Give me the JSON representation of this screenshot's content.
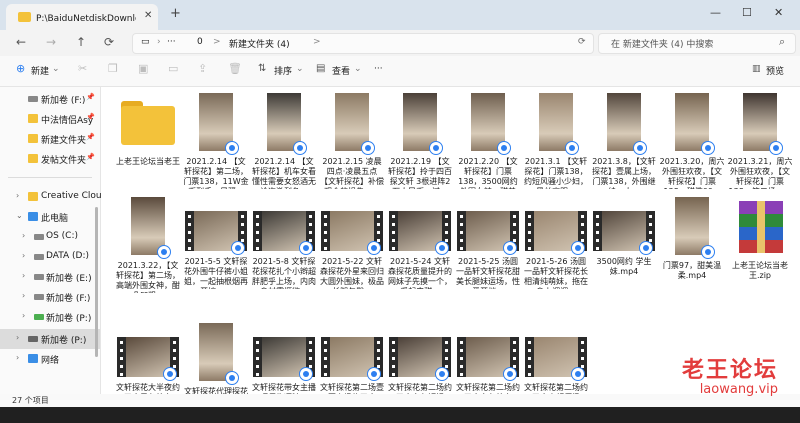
{
  "window": {
    "tab_title": "P:\\BaiduNetdiskDownload\\新建",
    "tab_close": "✕",
    "new_tab": "+",
    "controls": [
      "—",
      "☐",
      "✕"
    ]
  },
  "nav": {
    "back": "←",
    "forward": "→",
    "up": "↑",
    "refresh": "⟳",
    "path_more": "···",
    "path_root": "0",
    "path_sep": ">",
    "path_current": "新建文件夹 (4)",
    "path_chevron": ">",
    "search_placeholder": "在 新建文件夹 (4) 中搜索",
    "search_icon": "search-icon"
  },
  "toolbar": {
    "new_label": "新建",
    "sort_label": "排序",
    "view_label": "查看",
    "more_label": "···",
    "preview_label": "预览",
    "disabled_icons": [
      "cut-icon",
      "copy-icon",
      "paste-icon",
      "rename-icon",
      "share-icon",
      "delete-icon"
    ]
  },
  "sidebar": {
    "items": [
      {
        "label": "新加卷 (F:)",
        "pinned": true,
        "chev": "",
        "icon": "drive"
      },
      {
        "label": "中法情侣Asy",
        "pinned": true,
        "chev": "",
        "icon": "folder"
      },
      {
        "label": "新建文件夹",
        "pinned": true,
        "chev": "",
        "icon": "folder"
      },
      {
        "label": "发帖文件夹",
        "pinned": true,
        "chev": "",
        "icon": "folder"
      },
      {
        "label": "Creative Cloud",
        "pinned": false,
        "chev": "›",
        "icon": "cloud"
      },
      {
        "label": "此电脑",
        "pinned": false,
        "chev": "⌄",
        "icon": "pc"
      },
      {
        "label": "OS (C:)",
        "pinned": false,
        "chev": "›",
        "icon": "drive"
      },
      {
        "label": "DATA (D:)",
        "pinned": false,
        "chev": "›",
        "icon": "drive"
      },
      {
        "label": "新加卷 (E:)",
        "pinned": false,
        "chev": "›",
        "icon": "drive"
      },
      {
        "label": "新加卷 (F:)",
        "pinned": false,
        "chev": "›",
        "icon": "drive"
      },
      {
        "label": "新加卷 (P:)",
        "pinned": false,
        "chev": "›",
        "icon": "drive"
      },
      {
        "label": "新加卷 (P:)",
        "pinned": false,
        "chev": "›",
        "icon": "drive",
        "selected": true
      },
      {
        "label": "网络",
        "pinned": false,
        "chev": "›",
        "icon": "network"
      }
    ]
  },
  "files": [
    {
      "name": "上老王论坛当老王",
      "type": "folder",
      "sync": false
    },
    {
      "name": "2021.2.14 【文轩探花】第二场，门票138，11W金币到手，风骚...",
      "type": "photo",
      "sync": true
    },
    {
      "name": "2021.2.14 【文轩探花】机车女看懂性需要女怒酒无论次激烈争...",
      "type": "photo",
      "sync": true
    },
    {
      "name": "2021.2.15 凌晨四点·凌晨五点【文轩探花】补偿观众的损失，...",
      "type": "photo",
      "sync": true
    },
    {
      "name": "2021.2.19 【文轩探花】拎于四百探文轩 3根进阵2万人民币，过...",
      "type": "photo",
      "sync": true
    },
    {
      "name": "2021.2.20 【文轩探花】门票138，3500网约外围女神，甜美萌...",
      "type": "photo",
      "sync": true
    },
    {
      "name": "2021.3.1 【文轩探花】门票138，约短风骚小少妇，黑丝高跟...",
      "type": "photo",
      "sync": true
    },
    {
      "name": "2021.3.8，【文轩探花】壹属上场，门票138，外围继续，大...",
      "type": "photo",
      "sync": true
    },
    {
      "name": "2021.3.20，周六外围狂欢夜，【文轩探花】门票138，甜撒00...",
      "type": "photo",
      "sync": true
    },
    {
      "name": "2021.3.21，周六外围狂欢夜，【文轩探花】门票138，第二场，...",
      "type": "photo",
      "sync": true
    },
    {
      "name": "2021.3.22，【文轩探花】第二场，高端外围女神，酣凸凹粗...",
      "type": "photo",
      "sync": true
    },
    {
      "name": "2021-5-5 文轩探花外围牛仔裤小姐姐，一起抽根烟再开搞，...",
      "type": "video",
      "sync": true
    },
    {
      "name": "2021-5-8 文轩探花探花扎个小辫超胖肥乎上场，内肉身材需撅欲...",
      "type": "video",
      "sync": true
    },
    {
      "name": "2021-5-22 文轩森探花外星来回归大圆外围妹，极品长腿包臀...",
      "type": "video",
      "sync": true
    },
    {
      "name": "2021-5-24 文轩森探花质量提升的网妹子先摸一个，采起来甜...",
      "type": "video",
      "sync": true
    },
    {
      "name": "2021-5-25 汤圆一品轩文轩探花甜美长腿妹运场，性爱开档...",
      "type": "video",
      "sync": true
    },
    {
      "name": "2021-5-26 汤圆一品轩文轩探花长相清纯萌妹，拖在身上调调...",
      "type": "video",
      "sync": true
    },
    {
      "name": "3500网约 学生妹.mp4",
      "type": "video",
      "sync": true
    },
    {
      "name": "门票97，甜美温柔.mp4",
      "type": "photo",
      "sync": true
    },
    {
      "name": "上老王论坛当老王.zip",
      "type": "zip",
      "sync": false
    },
    {
      "name": "文轩探花大半夜约了个黑色外套",
      "type": "video",
      "sync": true
    },
    {
      "name": "文轩探花代理探花受命约操小熊",
      "type": "photo",
      "sync": true
    },
    {
      "name": "文轩探花带女主播旺仔牛逼糖一",
      "type": "video",
      "sync": true
    },
    {
      "name": "文轩探花第二场壹哥上场约了个",
      "type": "video",
      "sync": true
    },
    {
      "name": "文轩探花第二场约了个白色短裙",
      "type": "video",
      "sync": true
    },
    {
      "name": "文轩探花第二场约了个白色外套",
      "type": "video",
      "sync": true
    },
    {
      "name": "文轩探花第二场约了个高额僵极",
      "type": "video",
      "sync": true
    }
  ],
  "status": {
    "count": "27 个项目"
  },
  "watermark": {
    "cn": "老王论坛",
    "en": "laowang.vip"
  },
  "colors": {
    "folder": "#f3c23a",
    "accent": "#2d7ff0",
    "watermark": "#e23c3c"
  }
}
